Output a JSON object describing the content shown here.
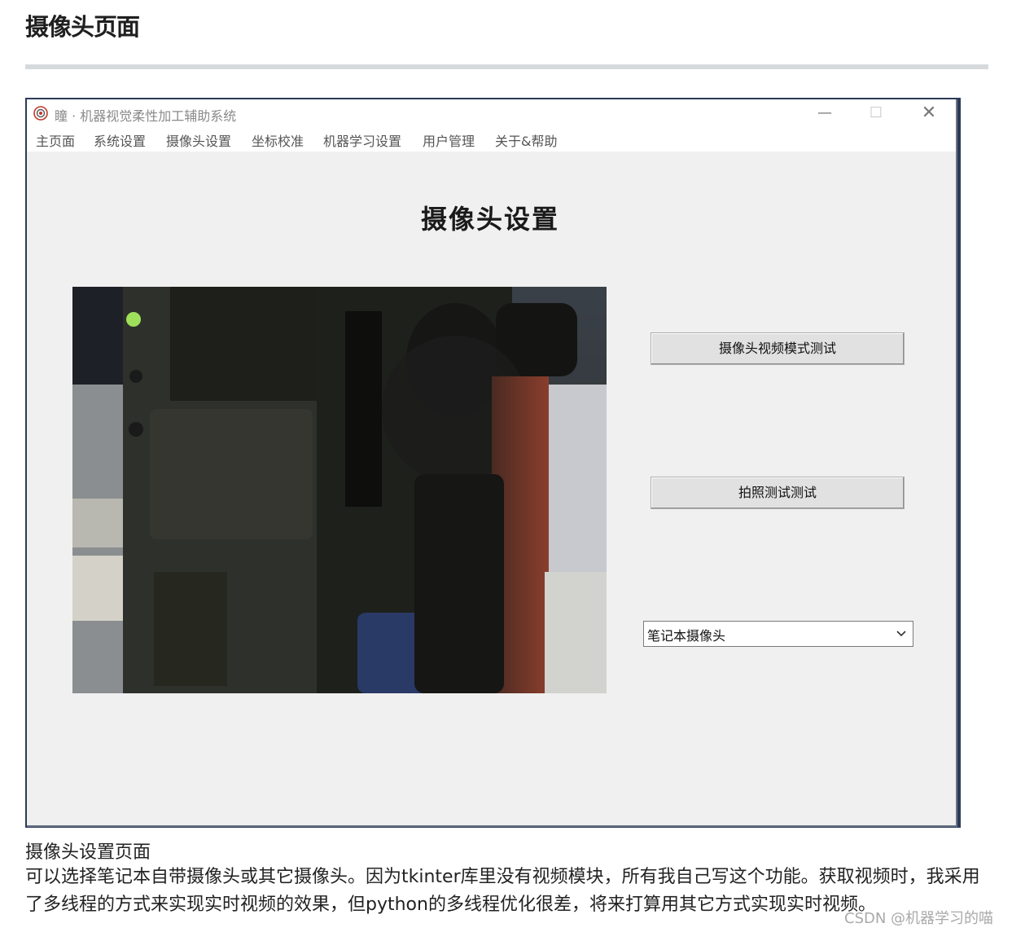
{
  "article": {
    "heading": "摄像头页面",
    "caption": "摄像头设置页面",
    "paragraph": "可以选择笔记本自带摄像头或其它摄像头。因为tkinter库里没有视频模块，所有我自己写这个功能。获取视频时，我采用了多线程的方式来实现实时视频的效果，但python的多线程优化很差，将来打算用其它方式实现实时视频。",
    "watermark": "CSDN @机器学习的喵"
  },
  "window": {
    "title": "瞳 · 机器视觉柔性加工辅助系统",
    "controls": {
      "minimize": "—",
      "maximize": "☐",
      "close": "✕"
    },
    "menu": [
      "主页面",
      "系统设置",
      "摄像头设置",
      "坐标校准",
      "机器学习设置",
      "用户管理",
      "关于&帮助"
    ]
  },
  "page": {
    "title": "摄像头设置",
    "video_test_button": "摄像头视频模式测试",
    "photo_test_button": "拍照测试测试",
    "camera_select": {
      "value": "笔记本摄像头"
    }
  },
  "icons": {
    "app": "app-logo-icon",
    "dropdown": "chevron-down-icon"
  }
}
